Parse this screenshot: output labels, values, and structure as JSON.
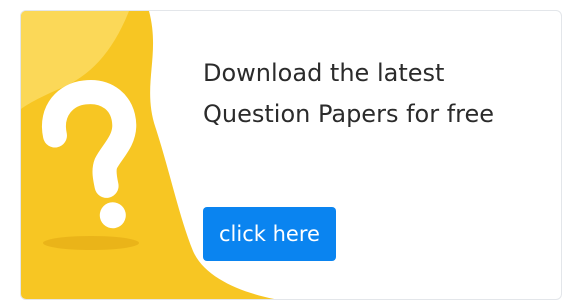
{
  "banner": {
    "headline": "Download the latest Question Papers for free",
    "cta_label": "click here",
    "illustration_icon": "question-mark-icon"
  },
  "colors": {
    "accent_yellow": "#f7c623",
    "light_yellow": "#fbd858",
    "button_blue": "#0a84f0"
  }
}
